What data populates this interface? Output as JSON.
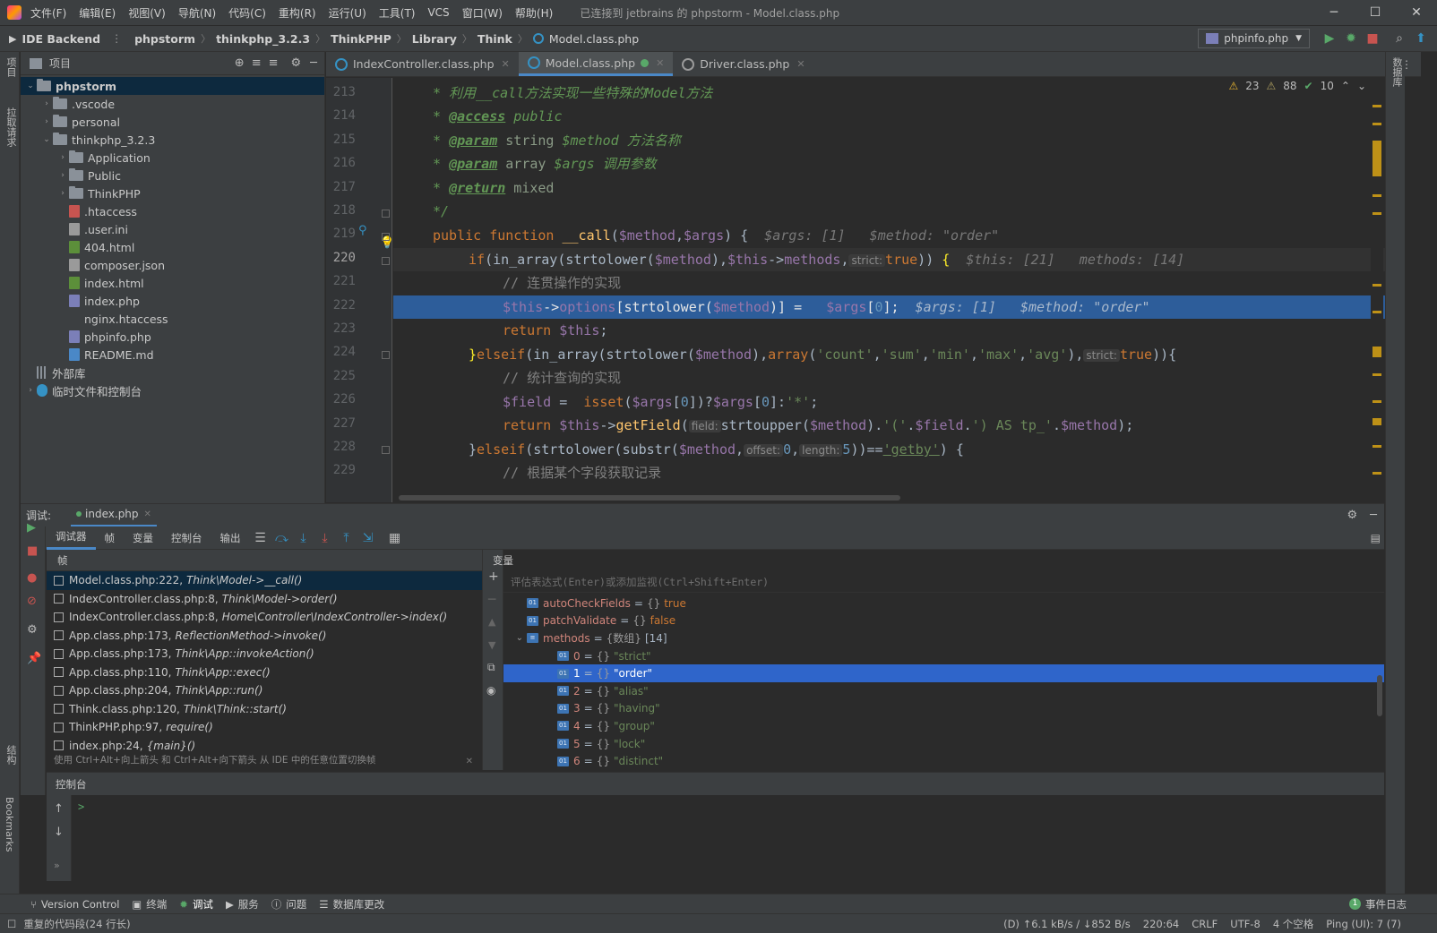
{
  "window": {
    "menus": [
      "文件(F)",
      "编辑(E)",
      "视图(V)",
      "导航(N)",
      "代码(C)",
      "重构(R)",
      "运行(U)",
      "工具(T)",
      "VCS",
      "窗口(W)",
      "帮助(H)"
    ],
    "title": "已连接到 jetbrains 的 phpstorm - Model.class.php"
  },
  "navbar": {
    "ide_backend": "IDE Backend",
    "crumbs": [
      "phpstorm",
      "thinkphp_3.2.3",
      "ThinkPHP",
      "Library",
      "Think",
      "Model.class.php"
    ],
    "run_config": "phpinfo.php"
  },
  "leftstrip": {
    "project": "项目",
    "pull_requests": "拉取请求",
    "structure": "结构",
    "bookmarks": "Bookmarks"
  },
  "rightstrip": {
    "database": "数据库"
  },
  "project": {
    "title": "项目",
    "tree": [
      {
        "label": "phpstorm",
        "indent": 0,
        "type": "folder",
        "open": true,
        "bold": true
      },
      {
        "label": ".vscode",
        "indent": 1,
        "type": "folder",
        "open": false
      },
      {
        "label": "personal",
        "indent": 1,
        "type": "folder",
        "open": false
      },
      {
        "label": "thinkphp_3.2.3",
        "indent": 1,
        "type": "folder",
        "open": true
      },
      {
        "label": "Application",
        "indent": 2,
        "type": "folder",
        "open": false
      },
      {
        "label": "Public",
        "indent": 2,
        "type": "folder",
        "open": false
      },
      {
        "label": "ThinkPHP",
        "indent": 2,
        "type": "folder",
        "open": false
      },
      {
        "label": ".htaccess",
        "indent": 2,
        "type": "file",
        "color": "#c75450"
      },
      {
        "label": ".user.ini",
        "indent": 2,
        "type": "file",
        "color": "#9a9a9a"
      },
      {
        "label": "404.html",
        "indent": 2,
        "type": "file",
        "color": "#5c8f3a"
      },
      {
        "label": "composer.json",
        "indent": 2,
        "type": "file",
        "color": "#9a9a9a"
      },
      {
        "label": "index.html",
        "indent": 2,
        "type": "file",
        "color": "#5c8f3a"
      },
      {
        "label": "index.php",
        "indent": 2,
        "type": "file",
        "color": "#7b7fb8"
      },
      {
        "label": "nginx.htaccess",
        "indent": 2,
        "type": "none"
      },
      {
        "label": "phpinfo.php",
        "indent": 2,
        "type": "file",
        "color": "#7b7fb8"
      },
      {
        "label": "README.md",
        "indent": 2,
        "type": "file",
        "color": "#4a88c7"
      },
      {
        "label": "外部库",
        "indent": 0,
        "type": "lib"
      },
      {
        "label": "临时文件和控制台",
        "indent": 0,
        "type": "scratch"
      }
    ]
  },
  "editor_tabs": [
    {
      "label": "IndexController.class.php",
      "active": false
    },
    {
      "label": "Model.class.php",
      "active": true
    },
    {
      "label": "Driver.class.php",
      "active": false
    }
  ],
  "inspections": {
    "warnings": "23",
    "weak_warnings": "88",
    "ok": "10"
  },
  "code": {
    "line_numbers": [
      "213",
      "214",
      "215",
      "216",
      "217",
      "218",
      "219",
      "220",
      "221",
      "222",
      "223",
      "224",
      "225",
      "226",
      "227",
      "228",
      "229"
    ],
    "current_line": "220",
    "exec_line": "222",
    "strict": "strict:",
    "field": "field:",
    "offset": "offset:",
    "length": "length:"
  },
  "debug": {
    "label": "调试:",
    "session": "index.php",
    "tabs": [
      "调试器",
      "帧",
      "变量",
      "控制台",
      "输出"
    ],
    "frames_title": "帧",
    "vars_title": "变量",
    "frames": [
      {
        "file": "Model.class.php:222,",
        "fn": "Think\\Model->__call()",
        "selected": true
      },
      {
        "file": "IndexController.class.php:8,",
        "fn": "Think\\Model->order()",
        "selected": false
      },
      {
        "file": "IndexController.class.php:8,",
        "fn": "Home\\Controller\\IndexController->index()",
        "selected": false
      },
      {
        "file": "App.class.php:173,",
        "fn": "ReflectionMethod->invoke()",
        "selected": false
      },
      {
        "file": "App.class.php:173,",
        "fn": "Think\\App::invokeAction()",
        "selected": false
      },
      {
        "file": "App.class.php:110,",
        "fn": "Think\\App::exec()",
        "selected": false
      },
      {
        "file": "App.class.php:204,",
        "fn": "Think\\App::run()",
        "selected": false
      },
      {
        "file": "Think.class.php:120,",
        "fn": "Think\\Think::start()",
        "selected": false
      },
      {
        "file": "ThinkPHP.php:97,",
        "fn": "require()",
        "selected": false
      },
      {
        "file": "index.php:24,",
        "fn": "{main}()",
        "selected": false
      }
    ],
    "frames_hint": "使用 Ctrl+Alt+向上箭头 和 Ctrl+Alt+向下箭头 从 IDE 中的任意位置切换帧",
    "eval_placeholder": "评估表达式(Enter)或添加监视(Ctrl+Shift+Enter)",
    "variables": [
      {
        "name": "autoCheckFields",
        "type": "{}",
        "value": "true",
        "kind": "bool",
        "indent": 0,
        "selected": false
      },
      {
        "name": "patchValidate",
        "type": "{}",
        "value": "false",
        "kind": "bool",
        "indent": 0,
        "selected": false
      },
      {
        "name": "methods",
        "type": "{数组}",
        "value": "[14]",
        "kind": "array",
        "indent": 0,
        "selected": false
      },
      {
        "name": "0",
        "type": "{}",
        "value": "\"strict\"",
        "kind": "str",
        "indent": 1,
        "selected": false
      },
      {
        "name": "1",
        "type": "{}",
        "value": "\"order\"",
        "kind": "str",
        "indent": 1,
        "selected": true
      },
      {
        "name": "2",
        "type": "{}",
        "value": "\"alias\"",
        "kind": "str",
        "indent": 1,
        "selected": false
      },
      {
        "name": "3",
        "type": "{}",
        "value": "\"having\"",
        "kind": "str",
        "indent": 1,
        "selected": false
      },
      {
        "name": "4",
        "type": "{}",
        "value": "\"group\"",
        "kind": "str",
        "indent": 1,
        "selected": false
      },
      {
        "name": "5",
        "type": "{}",
        "value": "\"lock\"",
        "kind": "str",
        "indent": 1,
        "selected": false
      },
      {
        "name": "6",
        "type": "{}",
        "value": "\"distinct\"",
        "kind": "str",
        "indent": 1,
        "selected": false
      }
    ],
    "console_title": "控制台",
    "console_prompt": ">"
  },
  "toolwindows": [
    {
      "label": "Version Control",
      "active": false
    },
    {
      "label": "终端",
      "active": false
    },
    {
      "label": "调试",
      "active": true
    },
    {
      "label": "服务",
      "active": false
    },
    {
      "label": "问题",
      "active": false
    },
    {
      "label": "数据库更改",
      "active": false
    }
  ],
  "event_log": {
    "count": "1",
    "label": "事件日志"
  },
  "status": {
    "message": "重复的代码段(24 行长)",
    "network": "(D) ↑6.1 kB/s / ↓852 B/s",
    "position": "220:64",
    "line_sep": "CRLF",
    "encoding": "UTF-8",
    "indent": "4 个空格",
    "ping": "Ping (UI): 7 (7)"
  },
  "colors": {
    "accent": "#4a88c7",
    "selection": "#2d5d9a",
    "var_selection": "#2f65ca"
  }
}
